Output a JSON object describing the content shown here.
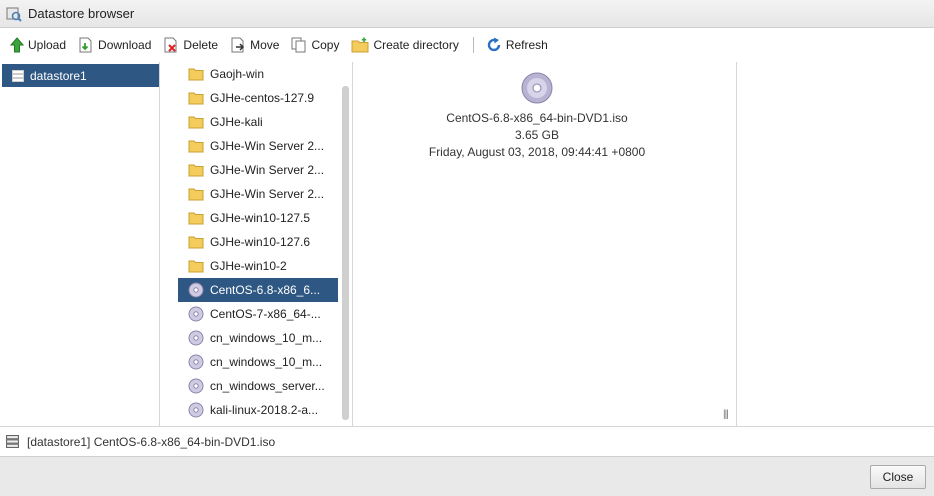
{
  "window": {
    "title": "Datastore browser"
  },
  "toolbar": {
    "upload": "Upload",
    "download": "Download",
    "delete": "Delete",
    "move": "Move",
    "copy": "Copy",
    "create_directory": "Create directory",
    "refresh": "Refresh"
  },
  "datastores": [
    {
      "label": "datastore1",
      "icon": "datastore-icon"
    }
  ],
  "files": [
    {
      "label": "Gaojh-win",
      "icon": "folder-icon"
    },
    {
      "label": "GJHe-centos-127.9",
      "icon": "folder-icon"
    },
    {
      "label": "GJHe-kali",
      "icon": "folder-icon"
    },
    {
      "label": "GJHe-Win Server 2...",
      "icon": "folder-icon"
    },
    {
      "label": "GJHe-Win Server 2...",
      "icon": "folder-icon"
    },
    {
      "label": "GJHe-Win Server 2...",
      "icon": "folder-icon"
    },
    {
      "label": "GJHe-win10-127.5",
      "icon": "folder-icon"
    },
    {
      "label": "GJHe-win10-127.6",
      "icon": "folder-icon"
    },
    {
      "label": "GJHe-win10-2",
      "icon": "folder-icon"
    },
    {
      "label": "CentOS-6.8-x86_6...",
      "icon": "disc-icon",
      "selected": true
    },
    {
      "label": "CentOS-7-x86_64-...",
      "icon": "disc-icon"
    },
    {
      "label": "cn_windows_10_m...",
      "icon": "disc-icon"
    },
    {
      "label": "cn_windows_10_m...",
      "icon": "disc-icon"
    },
    {
      "label": "cn_windows_server...",
      "icon": "disc-icon"
    },
    {
      "label": "kali-linux-2018.2-a...",
      "icon": "disc-icon"
    }
  ],
  "details": {
    "name": "CentOS-6.8-x86_64-bin-DVD1.iso",
    "size": "3.65 GB",
    "modified": "Friday, August 03, 2018, 09:44:41 +0800"
  },
  "status": {
    "path": "[datastore1] CentOS-6.8-x86_64-bin-DVD1.iso"
  },
  "footer": {
    "close": "Close"
  },
  "colors": {
    "selection": "#2e5883",
    "folder": "#f3cc5c"
  }
}
